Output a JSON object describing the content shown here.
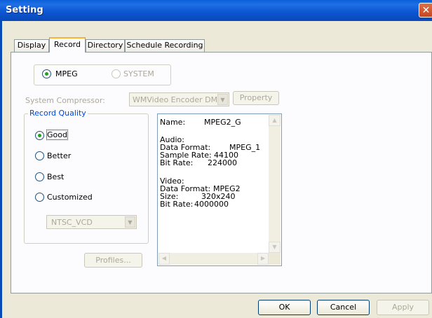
{
  "window": {
    "title": "Setting",
    "close_symbol": "✕"
  },
  "tabs": [
    {
      "label": "Display",
      "active": false
    },
    {
      "label": "Record",
      "active": true
    },
    {
      "label": "Directory",
      "active": false
    },
    {
      "label": "Schedule Recording",
      "active": false
    }
  ],
  "format": {
    "mpeg_label": "MPEG",
    "system_label": "SYSTEM",
    "selected": "MPEG"
  },
  "compressor": {
    "label": "System Compressor:",
    "value": "WMVideo Encoder DM",
    "property_label": "Property"
  },
  "quality": {
    "legend": "Record Quality",
    "options": [
      "Good",
      "Better",
      "Best",
      "Customized"
    ],
    "selected": "Good",
    "custom_value": "NTSC_VCD",
    "profiles_label": "Profiles..."
  },
  "info": {
    "name_label": "Name:",
    "name_value": "MPEG2_G",
    "audio_heading": "Audio:",
    "audio_format_label": "Data Format:",
    "audio_format_value": "MPEG_1",
    "sample_rate_label": "Sample Rate:",
    "sample_rate_value": "44100",
    "audio_bitrate_label": "Bit Rate:",
    "audio_bitrate_value": "224000",
    "video_heading": "Video:",
    "video_format_label": "Data Format:",
    "video_format_value": "MPEG2",
    "size_label": "Size:",
    "size_value": "320x240",
    "video_bitrate_label": "Bit Rate:",
    "video_bitrate_value": "4000000"
  },
  "footer": {
    "ok_label": "OK",
    "cancel_label": "Cancel",
    "apply_label": "Apply"
  },
  "icons": {
    "up": "▲",
    "down": "▼",
    "left": "◀",
    "right": "▶",
    "dropdown": "▼"
  },
  "colors": {
    "titlebar": "#0a5fd8",
    "radio_dot": "#21a121",
    "active_tab_accent": "#f8b430"
  }
}
